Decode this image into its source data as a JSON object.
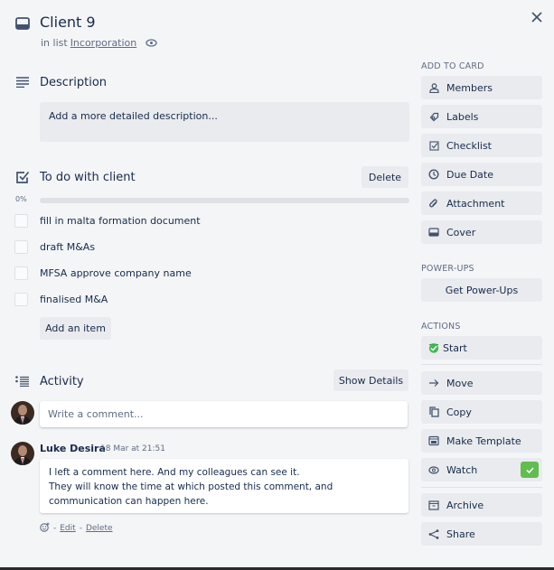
{
  "card": {
    "title": "Client 9",
    "list_prefix": "in list",
    "list_name": "Incorporation"
  },
  "description": {
    "heading": "Description",
    "placeholder": "Add a more detailed description..."
  },
  "checklist": {
    "heading": "To do with client",
    "delete_label": "Delete",
    "progress_percent": 0,
    "progress_label": "0%",
    "items": [
      {
        "text": "fill in malta formation document",
        "checked": false
      },
      {
        "text": "draft M&As",
        "checked": false
      },
      {
        "text": "MFSA approve company name",
        "checked": false
      },
      {
        "text": "finalised M&A",
        "checked": false
      }
    ],
    "add_item_label": "Add an item"
  },
  "activity": {
    "heading": "Activity",
    "show_details_label": "Show Details",
    "comment_placeholder": "Write a comment...",
    "comments": [
      {
        "author": "Luke Desira",
        "timestamp": "18 Mar at 21:51",
        "body": "I left a comment here. And my colleagues can see it.\nThey will know the time at which posted this comment, and communication can happen here.",
        "separator": "-",
        "edit_label": "Edit",
        "delete_label": "Delete"
      }
    ]
  },
  "sidebar": {
    "add_to_card_heading": "ADD TO CARD",
    "add_to_card": [
      {
        "label": "Members",
        "icon": "person-icon"
      },
      {
        "label": "Labels",
        "icon": "tag-icon"
      },
      {
        "label": "Checklist",
        "icon": "checkbox-icon"
      },
      {
        "label": "Due Date",
        "icon": "clock-icon"
      },
      {
        "label": "Attachment",
        "icon": "paperclip-icon"
      },
      {
        "label": "Cover",
        "icon": "cover-icon"
      }
    ],
    "power_ups_heading": "POWER-UPS",
    "get_power_ups_label": "Get Power-Ups",
    "actions_heading": "ACTIONS",
    "start_label": "Start",
    "actions": [
      {
        "label": "Move",
        "icon": "arrow-right-icon"
      },
      {
        "label": "Copy",
        "icon": "copy-icon"
      },
      {
        "label": "Make Template",
        "icon": "template-icon"
      },
      {
        "label": "Watch",
        "icon": "eye-icon",
        "active": true
      }
    ],
    "archive_label": "Archive",
    "share_label": "Share"
  },
  "colors": {
    "background": "#f4f5f7",
    "button": "#e9ebee",
    "text": "#172b4d",
    "muted": "#5e6c84",
    "watch_active": "#61bd4f"
  }
}
